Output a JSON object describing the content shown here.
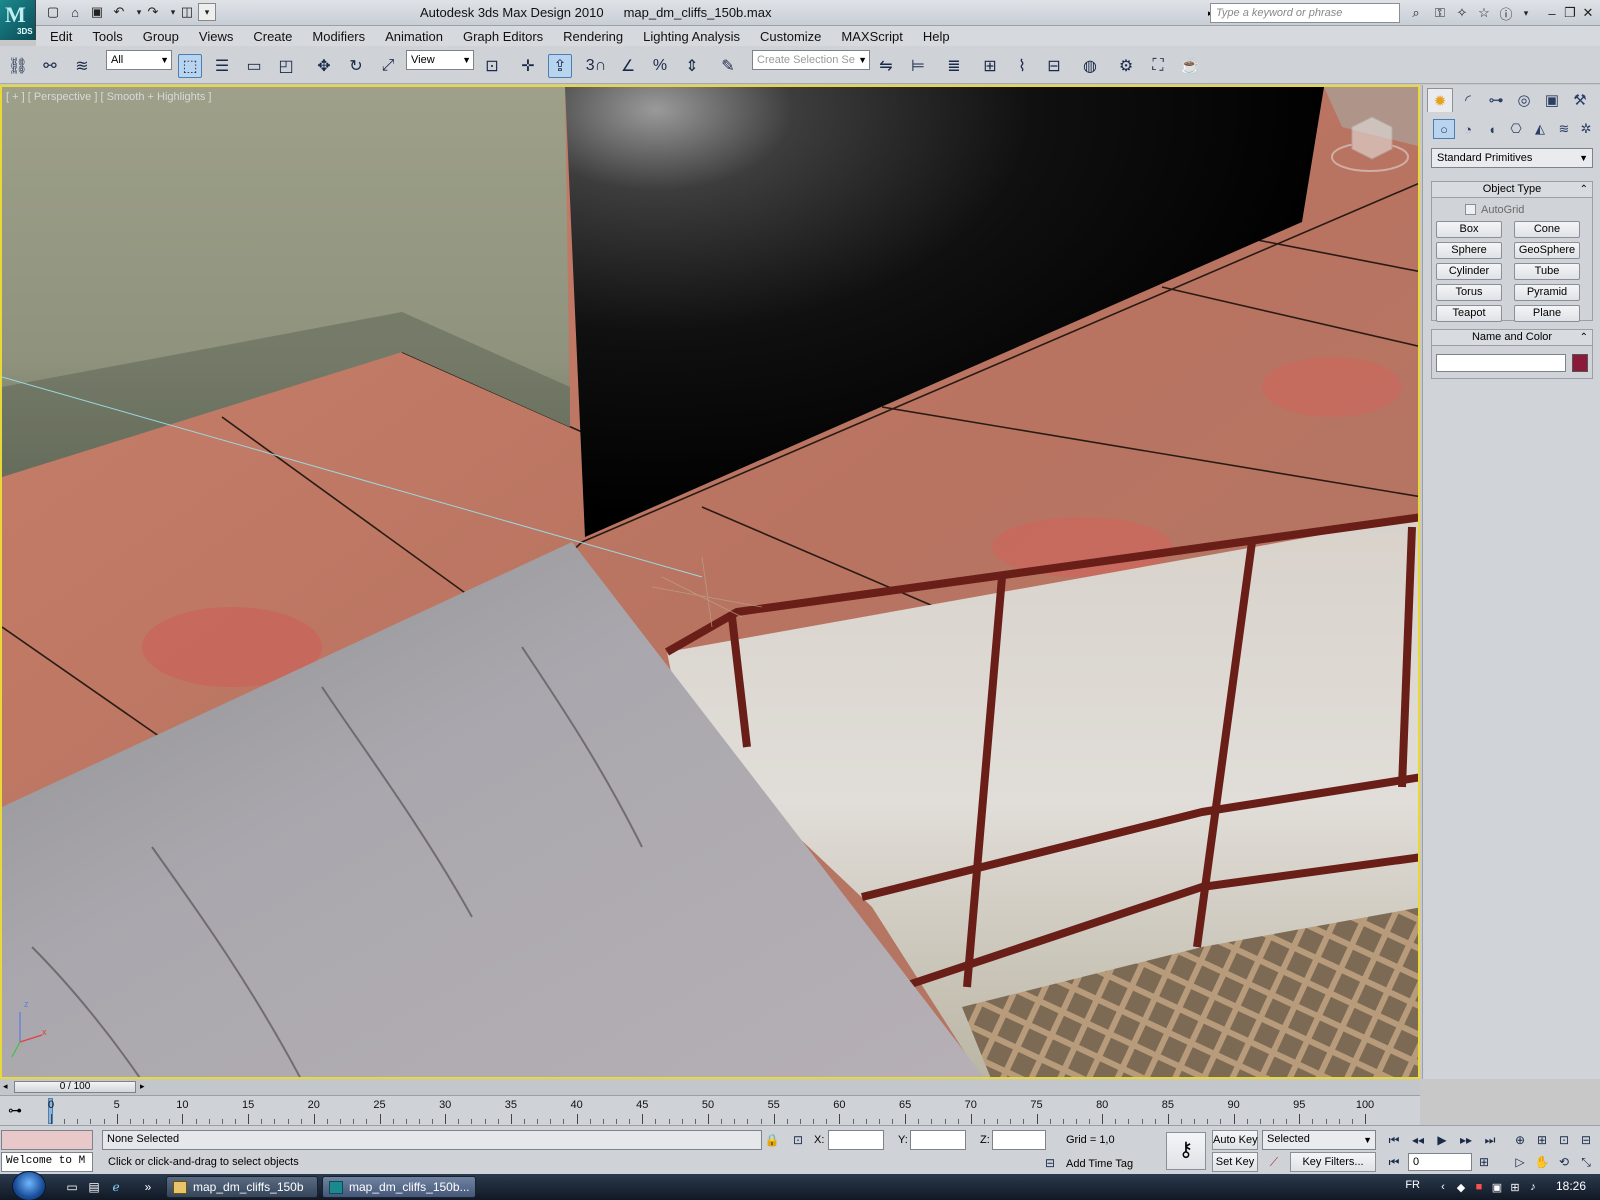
{
  "window": {
    "app_name": "Autodesk 3ds Max Design 2010",
    "file_name": "map_dm_cliffs_150b.max",
    "logo_text": "3DS",
    "search_placeholder": "Type a keyword or phrase"
  },
  "menu": [
    "Edit",
    "Tools",
    "Group",
    "Views",
    "Create",
    "Modifiers",
    "Animation",
    "Graph Editors",
    "Rendering",
    "Lighting Analysis",
    "Customize",
    "MAXScript",
    "Help"
  ],
  "toolbar": {
    "selection_filter": "All",
    "reference_coord": "View",
    "named_selection_placeholder": "Create Selection Se",
    "snap_label": "3"
  },
  "viewport": {
    "label": "[ + ] [ Perspective ] [ Smooth + Highlights ]",
    "axis_z": "z",
    "axis_x": "x"
  },
  "command_panel": {
    "category": "Standard Primitives",
    "object_type_title": "Object Type",
    "autogrid": "AutoGrid",
    "buttons": [
      "Box",
      "Cone",
      "Sphere",
      "GeoSphere",
      "Cylinder",
      "Tube",
      "Torus",
      "Pyramid",
      "Teapot",
      "Plane"
    ],
    "name_color_title": "Name and Color",
    "object_color": "#8b1a3a"
  },
  "timeline": {
    "slider_label": "0 / 100",
    "ticks": [
      0,
      5,
      10,
      15,
      20,
      25,
      30,
      35,
      40,
      45,
      50,
      55,
      60,
      65,
      70,
      75,
      80,
      85,
      90,
      95,
      100
    ]
  },
  "status": {
    "maxscript_listener": "Welcome to M",
    "selection": "None Selected",
    "prompt": "Click or click-and-drag to select objects",
    "x_label": "X:",
    "y_label": "Y:",
    "z_label": "Z:",
    "grid": "Grid = 1,0",
    "add_time_tag": "Add Time Tag",
    "auto_key": "Auto Key",
    "set_key": "Set Key",
    "key_mode": "Selected",
    "key_filters": "Key Filters...",
    "current_frame": "0"
  },
  "taskbar": {
    "tasks": [
      "map_dm_cliffs_150b",
      "map_dm_cliffs_150b..."
    ],
    "language": "FR",
    "clock": "18:26"
  }
}
